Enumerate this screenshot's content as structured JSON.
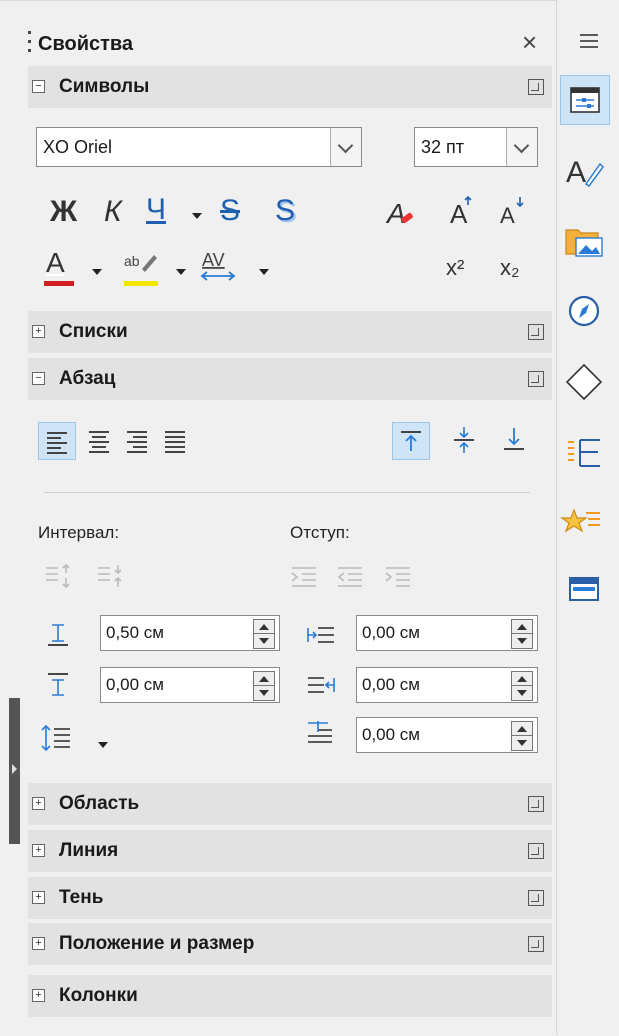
{
  "panel": {
    "title": "Свойства",
    "close_icon": "close-icon",
    "menu_icon": "hamburger-menu-icon"
  },
  "sections": {
    "symbols": "Символы",
    "lists": "Списки",
    "paragraph": "Абзац",
    "area": "Область",
    "line": "Линия",
    "shadow": "Тень",
    "position_size": "Положение и размер",
    "columns": "Колонки"
  },
  "symbols": {
    "font_name": "XO Oriel",
    "font_size": "32 пт",
    "bold": "Ж",
    "italic": "К",
    "underline": "Ч",
    "strikethrough": "S",
    "shadow": "S",
    "grow": "A",
    "shrink": "A",
    "font_color": "A",
    "highlight": "ab",
    "spacing": "AV",
    "superscript": "x²",
    "subscript": "x₂",
    "colors": {
      "font": "#d21f1f",
      "highlight": "#f5e600",
      "spacing_arrow": "#2a7bd6"
    }
  },
  "paragraph": {
    "spacing_label": "Интервал:",
    "indent_label": "Отступ:",
    "above_spacing": "0,50 см",
    "below_spacing": "0,00 см",
    "before_indent": "0,00 см",
    "after_indent": "0,00 см",
    "first_line_indent": "0,00 см"
  },
  "tabs": [
    "properties",
    "styles",
    "gallery",
    "navigator",
    "shapes",
    "page",
    "style-inspector",
    "design"
  ]
}
